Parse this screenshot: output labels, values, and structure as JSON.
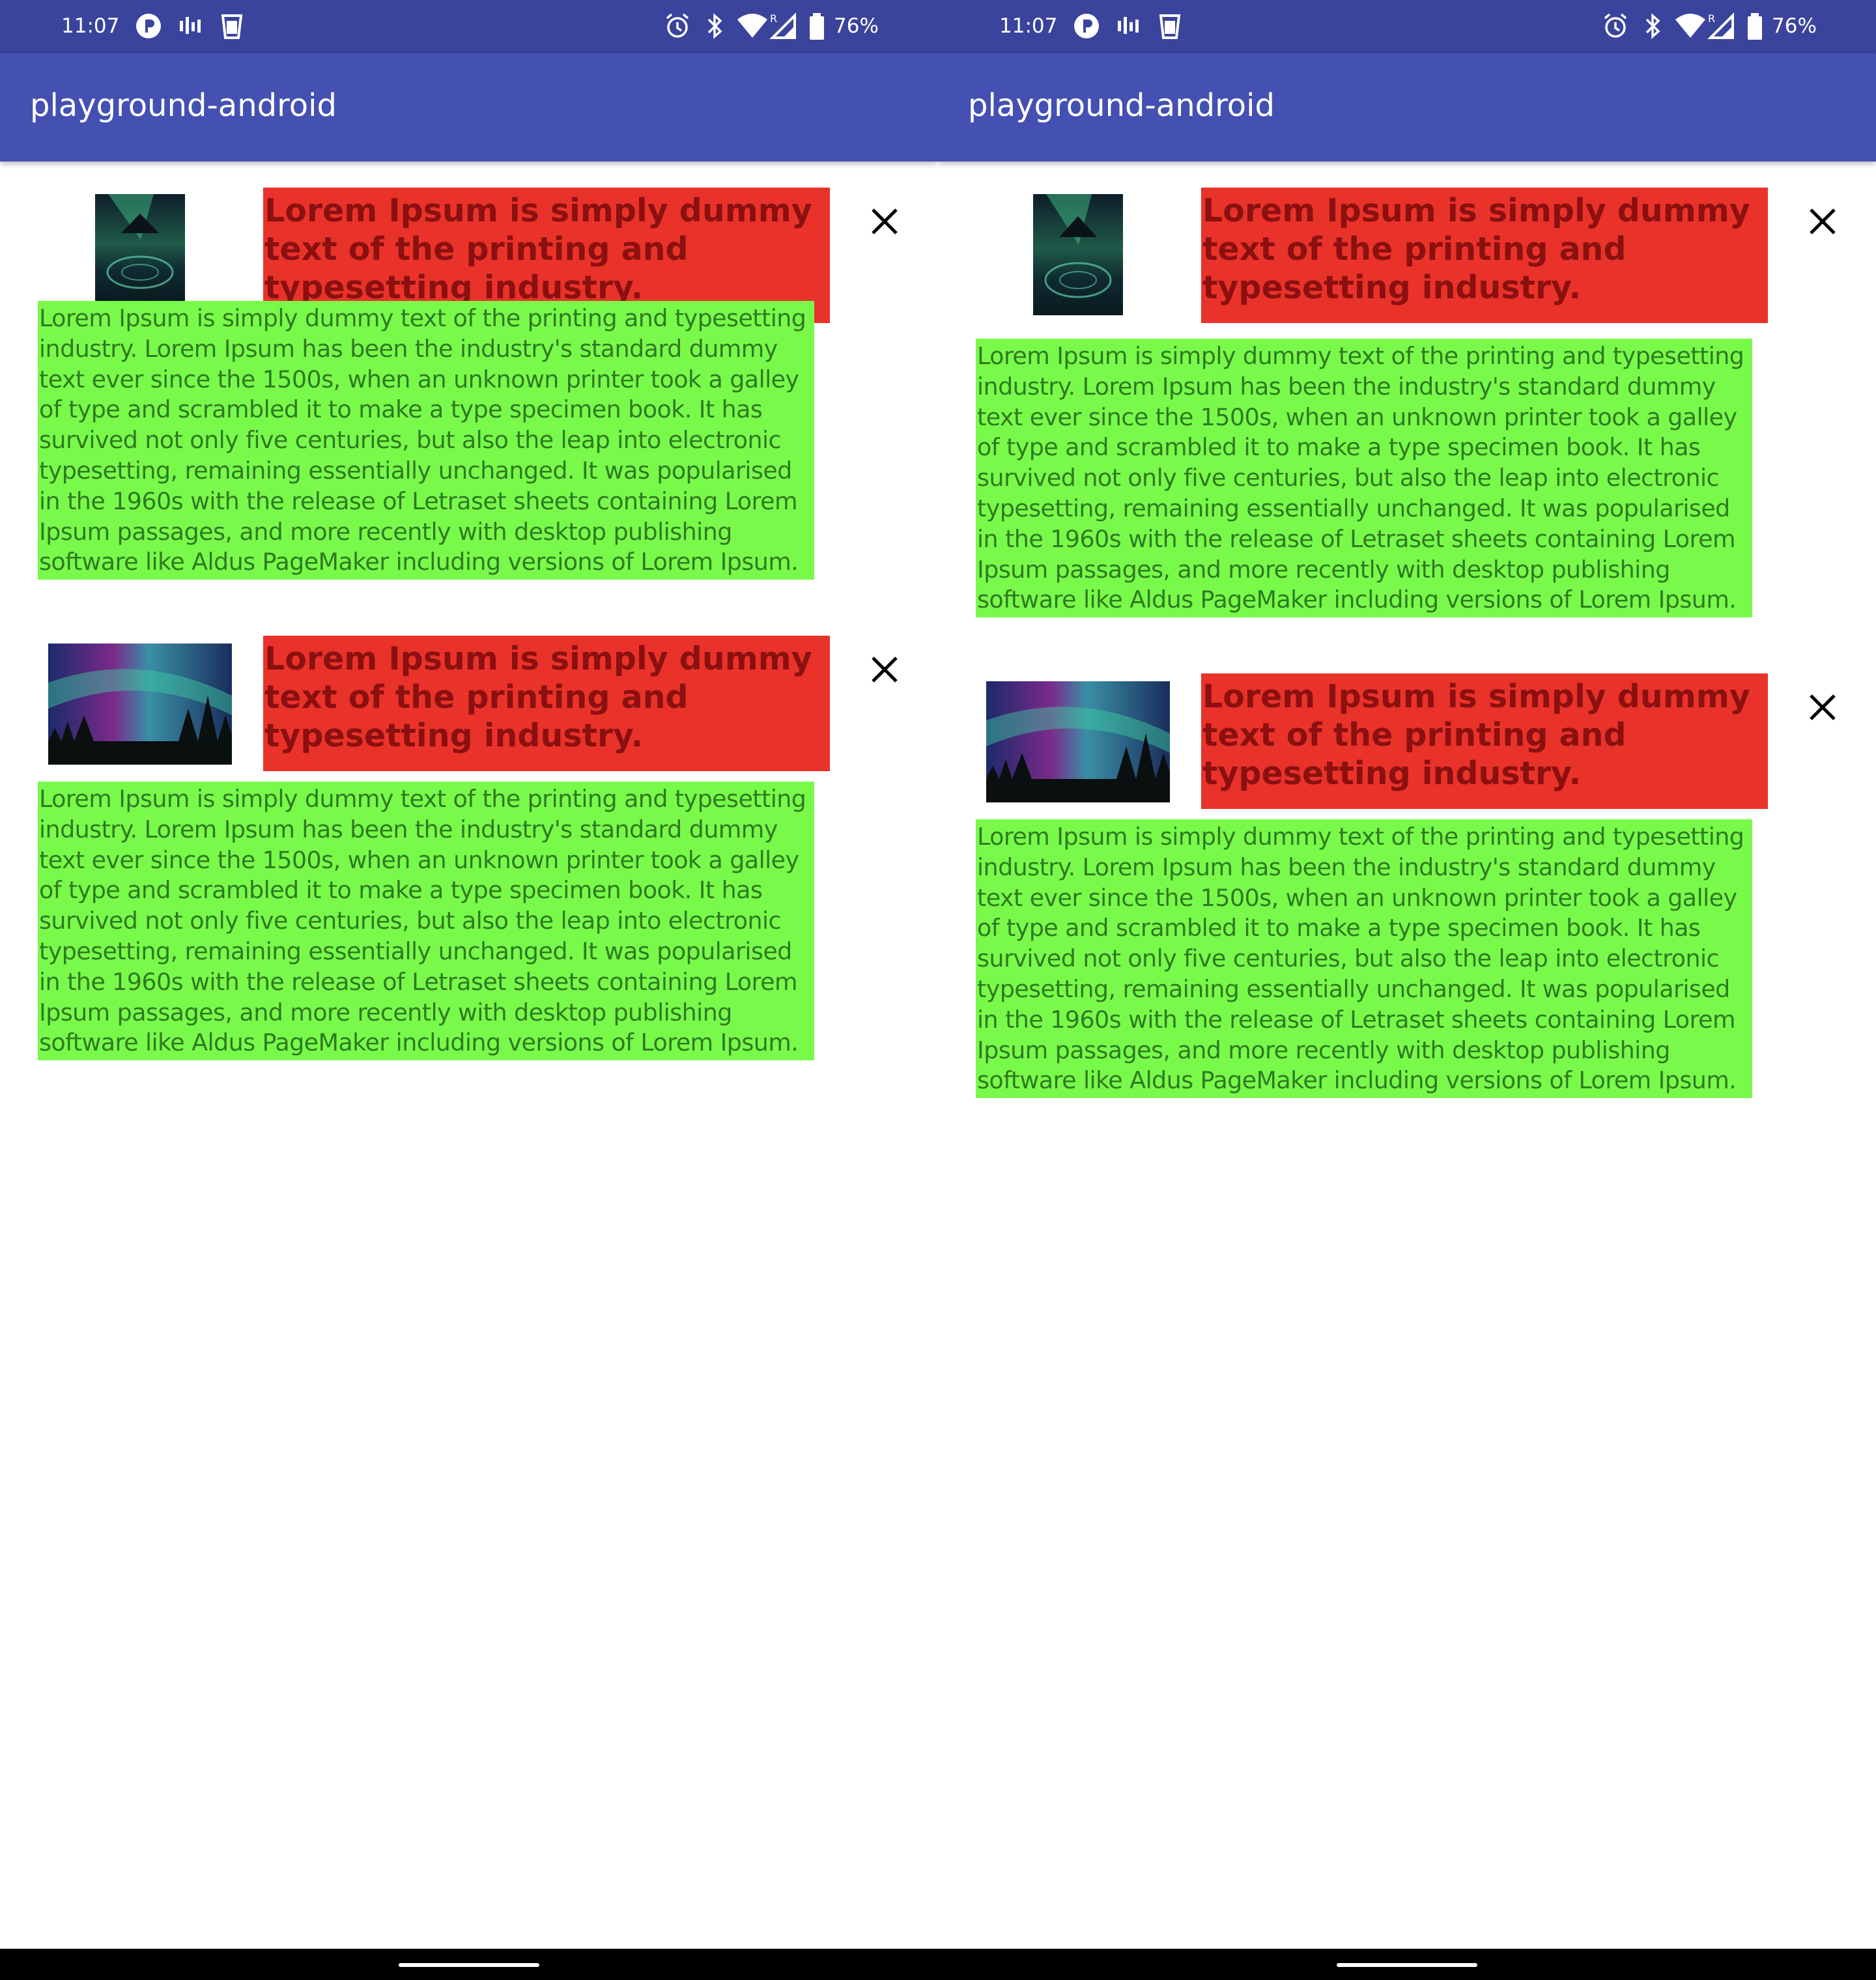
{
  "status_bar": {
    "time": "11:07",
    "battery": "76%",
    "left_icons": [
      "notification-p-icon",
      "signal-bars-icon",
      "cup-icon"
    ],
    "right_icons": [
      "alarm-icon",
      "bluetooth-icon",
      "wifi-icon",
      "cellular-roaming-icon",
      "battery-icon"
    ]
  },
  "app_bar": {
    "title": "playground-android"
  },
  "cards": [
    {
      "image_name": "aurora-portrait-image",
      "title": "Lorem Ipsum is simply dummy text of the printing and typesetting industry.",
      "body": "Lorem Ipsum is simply dummy text of the printing and typesetting industry. Lorem Ipsum has been the industry's standard dummy text ever since the 1500s, when an unknown printer took a galley of type and scrambled it to make a type specimen book. It has survived not only five centuries, but also the leap into electronic typesetting, remaining essentially unchanged. It was popularised in the 1960s with the release of Letraset sheets containing Lorem Ipsum passages, and more recently with desktop publishing software like Aldus PageMaker including versions of Lorem Ipsum."
    },
    {
      "image_name": "aurora-landscape-image",
      "title": "Lorem Ipsum is simply dummy text of the printing and typesetting industry.",
      "body": "Lorem Ipsum is simply dummy text of the printing and typesetting industry. Lorem Ipsum has been the industry's standard dummy text ever since the 1500s, when an unknown printer took a galley of type and scrambled it to make a type specimen book. It has survived not only five centuries, but also the leap into electronic typesetting, remaining essentially unchanged. It was popularised in the 1960s with the release of Letraset sheets containing Lorem Ipsum passages, and more recently with desktop publishing software like Aldus PageMaker including versions of Lorem Ipsum."
    }
  ],
  "colors": {
    "status_bar": "#3a449c",
    "app_bar": "#4450b2",
    "title_background": "#e9322a",
    "title_text": "#8b1010",
    "body_background": "#79fa4b",
    "body_text": "#2f7a21"
  }
}
